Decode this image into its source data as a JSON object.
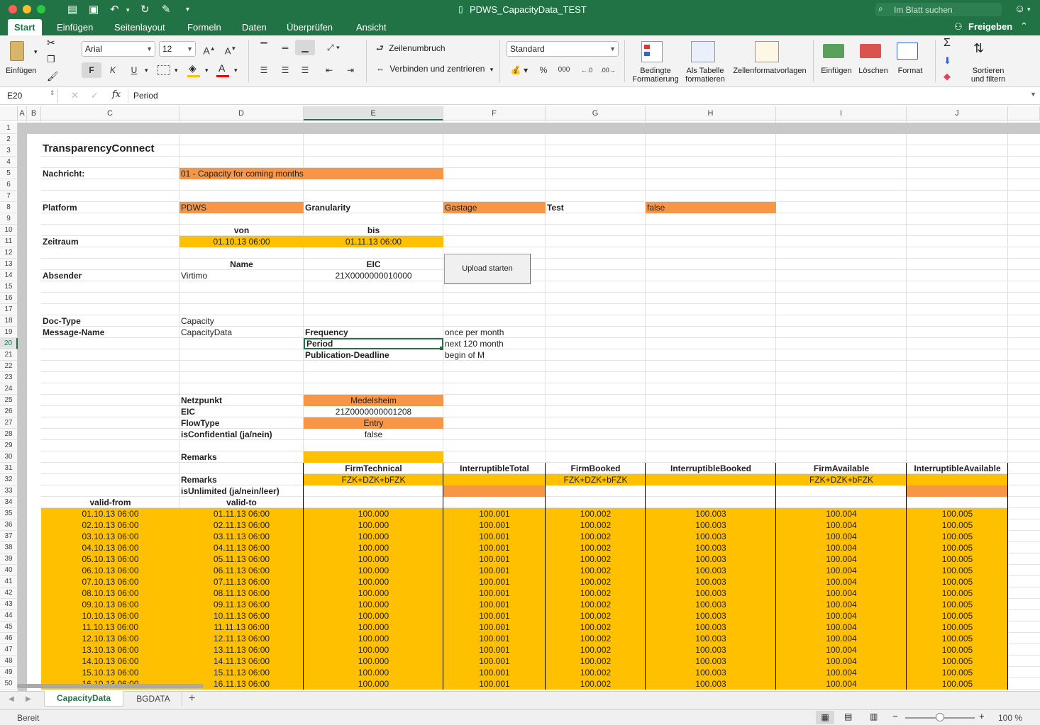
{
  "window": {
    "title": "PDWS_CapacityData_TEST",
    "search_placeholder": "Im Blatt suchen",
    "colors": {
      "brand": "#217346"
    }
  },
  "tabs": [
    "Start",
    "Einfügen",
    "Seitenlayout",
    "Formeln",
    "Daten",
    "Überprüfen",
    "Ansicht"
  ],
  "share_label": "Freigeben",
  "ribbon": {
    "paste_label": "Einfügen",
    "font_name": "Arial",
    "font_size": "12",
    "bold": "F",
    "italic": "K",
    "underline": "U",
    "wrap_label": "Zeilenumbruch",
    "merge_label": "Verbinden und zentrieren",
    "number_format": "Standard",
    "percent": "%",
    "thousands": "000",
    "cond_format_label": "Bedingte Formatierung",
    "table_format_label": "Als Tabelle formatieren",
    "cell_styles_label": "Zellenformatvorlagen",
    "insert_label": "Einfügen",
    "delete_label": "Löschen",
    "format_label": "Format",
    "sort_label": "Sortieren und filtern"
  },
  "formula_bar": {
    "cell_ref": "E20",
    "fx": "fx",
    "value": "Period"
  },
  "columns": [
    "A",
    "B",
    "C",
    "D",
    "E",
    "F",
    "G",
    "H",
    "I",
    "J"
  ],
  "rows": [
    "1",
    "2",
    "3",
    "4",
    "5",
    "6",
    "7",
    "8",
    "9",
    "10",
    "11",
    "12",
    "13",
    "14",
    "15",
    "16",
    "17",
    "18",
    "19",
    "20",
    "21",
    "22",
    "23",
    "24",
    "25",
    "26",
    "27",
    "28",
    "29",
    "30",
    "31",
    "32",
    "33",
    "34",
    "35",
    "36",
    "37",
    "38",
    "39",
    "40",
    "41",
    "42",
    "43",
    "44",
    "45",
    "46",
    "47",
    "48",
    "49",
    "50"
  ],
  "upload_button": "Upload starten",
  "cells": {
    "title": "TransparencyConnect",
    "nachricht_label": "Nachricht:",
    "nachricht_value": "01 - Capacity for coming months",
    "platform_label": "Platform",
    "platform_value": "PDWS",
    "granularity_label": "Granularity",
    "granularity_value": "Gastage",
    "test_label": "Test",
    "test_value": "false",
    "von": "von",
    "bis": "bis",
    "zeitraum_label": "Zeitraum",
    "zeitraum_von": "01.10.13 06:00",
    "zeitraum_bis": "01.11.13 06:00",
    "name_hdr": "Name",
    "eic_hdr": "EIC",
    "absender_label": "Absender",
    "absender_name": "Virtimo",
    "absender_eic": "21X0000000010000",
    "doctype_label": "Doc-Type",
    "doctype_value": "Capacity",
    "msgname_label": "Message-Name",
    "msgname_value": "CapacityData",
    "frequency_label": "Frequency",
    "frequency_value": "once per month",
    "period_label": "Period",
    "period_value": "next 120 month",
    "deadline_label": "Publication-Deadline",
    "deadline_value": "begin of M",
    "netzpunkt_label": "Netzpunkt",
    "netzpunkt_value": "Medelsheim",
    "eic_label": "EIC",
    "eic_value": "21Z0000000001208",
    "flowtype_label": "FlowType",
    "flowtype_value": "Entry",
    "confidential_label": "isConfidential (ja/nein)",
    "confidential_value": "false",
    "remarks30_label": "Remarks",
    "remarks32_label": "Remarks",
    "unlimited_label": "isUnlimited (ja/nein/leer)",
    "validfrom_hdr": "valid-from",
    "validto_hdr": "valid-to"
  },
  "capacity_headers": [
    "FirmTechnical",
    "InterruptibleTotal",
    "FirmBooked",
    "InterruptibleBooked",
    "FirmAvailable",
    "InterruptibleAvailable"
  ],
  "remarks_values": [
    "FZK+DZK+bFZK",
    "",
    "FZK+DZK+bFZK",
    "",
    "FZK+DZK+bFZK",
    ""
  ],
  "data_rows": [
    {
      "from": "01.10.13 06:00",
      "to": "01.11.13 06:00"
    },
    {
      "from": "02.10.13 06:00",
      "to": "02.11.13 06:00"
    },
    {
      "from": "03.10.13 06:00",
      "to": "03.11.13 06:00"
    },
    {
      "from": "04.10.13 06:00",
      "to": "04.11.13 06:00"
    },
    {
      "from": "05.10.13 06:00",
      "to": "05.11.13 06:00"
    },
    {
      "from": "06.10.13 06:00",
      "to": "06.11.13 06:00"
    },
    {
      "from": "07.10.13 06:00",
      "to": "07.11.13 06:00"
    },
    {
      "from": "08.10.13 06:00",
      "to": "08.11.13 06:00"
    },
    {
      "from": "09.10.13 06:00",
      "to": "09.11.13 06:00"
    },
    {
      "from": "10.10.13 06:00",
      "to": "10.11.13 06:00"
    },
    {
      "from": "11.10.13 06:00",
      "to": "11.11.13 06:00"
    },
    {
      "from": "12.10.13 06:00",
      "to": "12.11.13 06:00"
    },
    {
      "from": "13.10.13 06:00",
      "to": "13.11.13 06:00"
    },
    {
      "from": "14.10.13 06:00",
      "to": "14.11.13 06:00"
    },
    {
      "from": "15.10.13 06:00",
      "to": "15.11.13 06:00"
    },
    {
      "from": "16.10.13 06:00",
      "to": "16.11.13 06:00"
    }
  ],
  "capacity_values": [
    "100.000",
    "100.001",
    "100.002",
    "100.003",
    "100.004",
    "100.005"
  ],
  "sheet_tabs": [
    "CapacityData",
    "BGDATA"
  ],
  "add_sheet": "+",
  "status": {
    "text": "Bereit",
    "zoom": "100 %",
    "zoom_fraction": 0.5
  },
  "fill_colors": {
    "orange": "#f79646",
    "yellow": "#ffc000"
  }
}
